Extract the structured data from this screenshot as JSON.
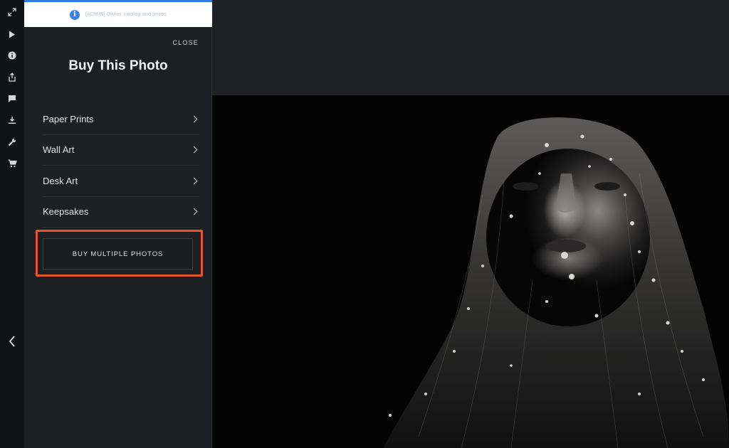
{
  "rail": {
    "icons": [
      "expand-icon",
      "play-icon",
      "info-icon",
      "share-icon",
      "comment-icon",
      "download-icon",
      "wrench-icon",
      "cart-icon",
      "chevron-left-icon"
    ]
  },
  "notice": {
    "text": "[ADMIN] Owner catalog and prices"
  },
  "panel": {
    "close_label": "CLOSE",
    "title": "Buy This Photo",
    "menu": [
      {
        "label": "Paper Prints"
      },
      {
        "label": "Wall Art"
      },
      {
        "label": "Desk Art"
      },
      {
        "label": "Keepsakes"
      }
    ],
    "buy_multiple_label": "BUY MULTIPLE PHOTOS"
  },
  "colors": {
    "accent_blue": "#3b82e6",
    "highlight_orange": "#e3562c",
    "panel_bg": "#1d1f22",
    "rail_bg": "#111214",
    "viewer_bg": "#030304"
  }
}
